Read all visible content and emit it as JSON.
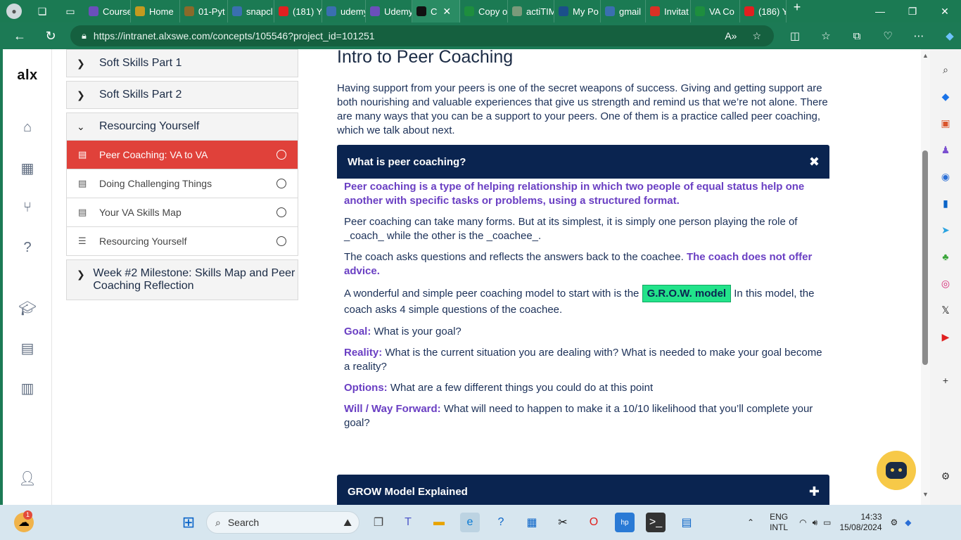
{
  "browser": {
    "tabs": [
      {
        "label": "Course",
        "color": "#6b4fbb"
      },
      {
        "label": "Home",
        "color": "#c49a1f"
      },
      {
        "label": "01-Pyt",
        "color": "#8a6a2a"
      },
      {
        "label": "snapcl",
        "color": "#3a6fb0"
      },
      {
        "label": "(181) Y",
        "color": "#e02020"
      },
      {
        "label": "udemy",
        "color": "#3a6fb0"
      },
      {
        "label": "Udemy",
        "color": "#6b4fbb"
      },
      {
        "label": "C",
        "color": "#111111"
      },
      {
        "label": "Copy o",
        "color": "#1e8e3e"
      },
      {
        "label": "actiTIM",
        "color": "#7a9a7a"
      },
      {
        "label": "My Po",
        "color": "#1b4f8a"
      },
      {
        "label": "gmail",
        "color": "#3a6fb0"
      },
      {
        "label": "Invitat",
        "color": "#d93025"
      },
      {
        "label": "VA Co",
        "color": "#1e8e3e"
      },
      {
        "label": "(186) Y",
        "color": "#e02020"
      }
    ],
    "url": "https://intranet.alxswe.com/concepts/105546?project_id=101251"
  },
  "rail": {
    "logo": "alx",
    "items": [
      "home-icon",
      "calendar-icon",
      "fork-icon",
      "help-icon",
      "graduation-cap-icon",
      "document-icon",
      "film-icon",
      "user-icon"
    ]
  },
  "outline": {
    "sections": [
      {
        "label": "Soft Skills Part 1"
      },
      {
        "label": "Soft Skills Part 2"
      },
      {
        "label": "Resourcing Yourself"
      }
    ],
    "lessons": [
      {
        "label": "Peer Coaching: VA to VA",
        "icon": "document-icon"
      },
      {
        "label": "Doing Challenging Things",
        "icon": "document-icon"
      },
      {
        "label": "Your VA Skills Map",
        "icon": "document-icon"
      },
      {
        "label": "Resourcing Yourself",
        "icon": "checklist-icon"
      }
    ],
    "milestone": "Week #2 Milestone: Skills Map and Peer Coaching Reflection"
  },
  "content": {
    "title": "Intro to Peer Coaching",
    "intro": "Having support from your peers is one of the secret weapons of success. Giving and getting support are both nourishing and valuable experiences that give us strength and remind us that we’re not alone. There are many ways that you can be a support to your peers. One of them is a practice called peer coaching, which we talk about next.",
    "accordion1": {
      "title": "What is peer coaching?",
      "definition": "Peer coaching is a type of helping relationship in which two people of equal status help one another with specific tasks or problems, using a structured format.",
      "p2": "Peer coaching can take many forms. But at its simplest, it is simply one person playing the role of _coach_ while the other is the _coachee_.",
      "p3_plain": "The coach asks questions and reflects the answers back to the coachee.",
      "p3_bold": "The coach does not offer advice.",
      "p4_before": "A wonderful and simple peer coaching model to start with is the",
      "p4_highlight": "G.R.O.W. model",
      "p4_after": "In this model, the coach asks 4 simple questions of the coachee.",
      "goal_label": "Goal:",
      "goal_text": "What is your goal?",
      "reality_label": "Reality:",
      "reality_text": "What is the current situation you are dealing with? What is needed to make your goal become a reality?",
      "options_label": "Options:",
      "options_text": "What are a few different things you could do at this point",
      "will_label": "Will / Way Forward:",
      "will_text": "What will need to happen to make it a 10/10 likelihood that you’ll complete your goal?"
    },
    "accordion2": {
      "title": "GROW Model Explained"
    }
  },
  "taskbar": {
    "search_placeholder": "Search",
    "notification_badge": "1",
    "lang1": "ENG",
    "lang2": "INTL",
    "time": "14:33",
    "date": "15/08/2024"
  }
}
